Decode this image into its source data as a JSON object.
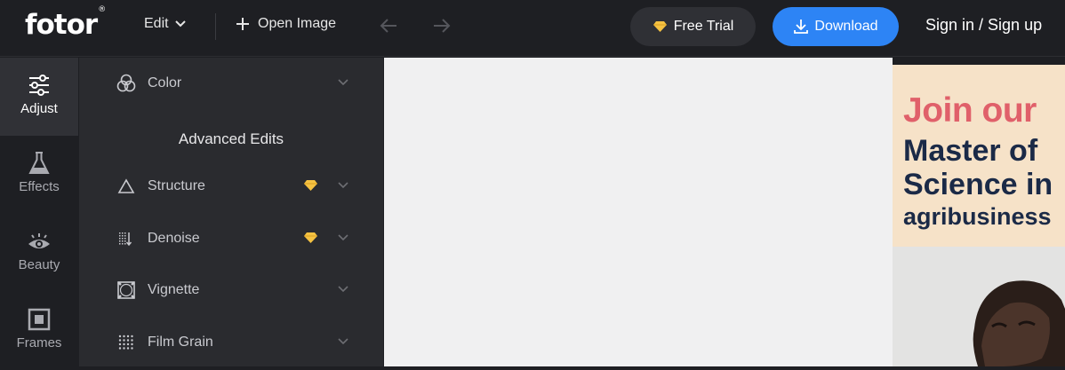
{
  "topbar": {
    "logo": "fotor",
    "logo_mark": "®",
    "edit_label": "Edit",
    "open_image_label": "Open Image",
    "free_trial_label": "Free Trial",
    "download_label": "Download",
    "signin_label": "Sign in / Sign up"
  },
  "leftnav": {
    "items": [
      {
        "label": "Adjust",
        "icon": "sliders-icon",
        "active": true
      },
      {
        "label": "Effects",
        "icon": "flask-icon"
      },
      {
        "label": "Beauty",
        "icon": "eye-icon"
      },
      {
        "label": "Frames",
        "icon": "frame-icon"
      }
    ]
  },
  "panel": {
    "color_label": "Color",
    "section_title": "Advanced Edits",
    "rows": [
      {
        "label": "Structure",
        "icon": "triangle-icon",
        "premium": true
      },
      {
        "label": "Denoise",
        "icon": "denoise-icon",
        "premium": true
      },
      {
        "label": "Vignette",
        "icon": "vignette-icon",
        "premium": false
      },
      {
        "label": "Film Grain",
        "icon": "grain-icon",
        "premium": false
      }
    ]
  },
  "ad": {
    "line1": "Join our",
    "line2": "Master of",
    "line3": "Science in",
    "line4": "agribusiness"
  },
  "colors": {
    "accent": "#2d84f5",
    "premium_gem": "#f5c242",
    "ad_heading_red": "#e0606a",
    "ad_heading_navy": "#1b2a47"
  }
}
